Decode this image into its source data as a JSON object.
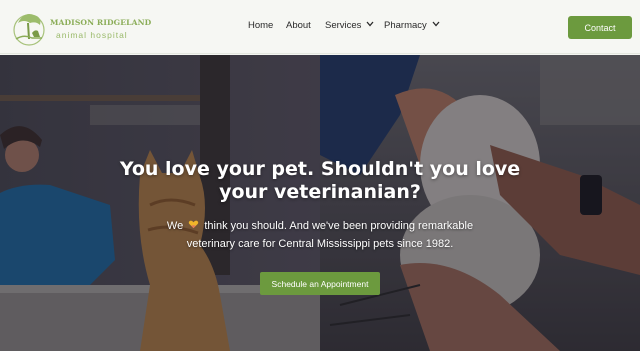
{
  "brand": {
    "name_line1": "MADISON RIDGELAND",
    "name_line2": "animal hospital",
    "logo_icon": "tree-and-dog-logo"
  },
  "nav": {
    "items": [
      {
        "label": "Home",
        "has_dropdown": false
      },
      {
        "label": "About",
        "has_dropdown": false
      },
      {
        "label": "Services",
        "has_dropdown": true
      },
      {
        "label": "Pharmacy",
        "has_dropdown": true
      }
    ],
    "contact_label": "Contact"
  },
  "hero": {
    "headline_line1": "You love your pet. Shouldn't you love",
    "headline_line2": "your veterinanian?",
    "sub_line1_before": "We",
    "sub_line1_after": "think you should. And we've been providing remarkable",
    "sub_line2": "veterinary care for Central Mississippi pets since 1982.",
    "inline_icon": "heart-hands-emoji",
    "cta_label": "Schedule an Appointment"
  },
  "colors": {
    "accent": "#6c9a3e",
    "logo_green": "#8bad58",
    "header_bg": "#f6f7f3",
    "text_dark": "#2a2a2a"
  }
}
